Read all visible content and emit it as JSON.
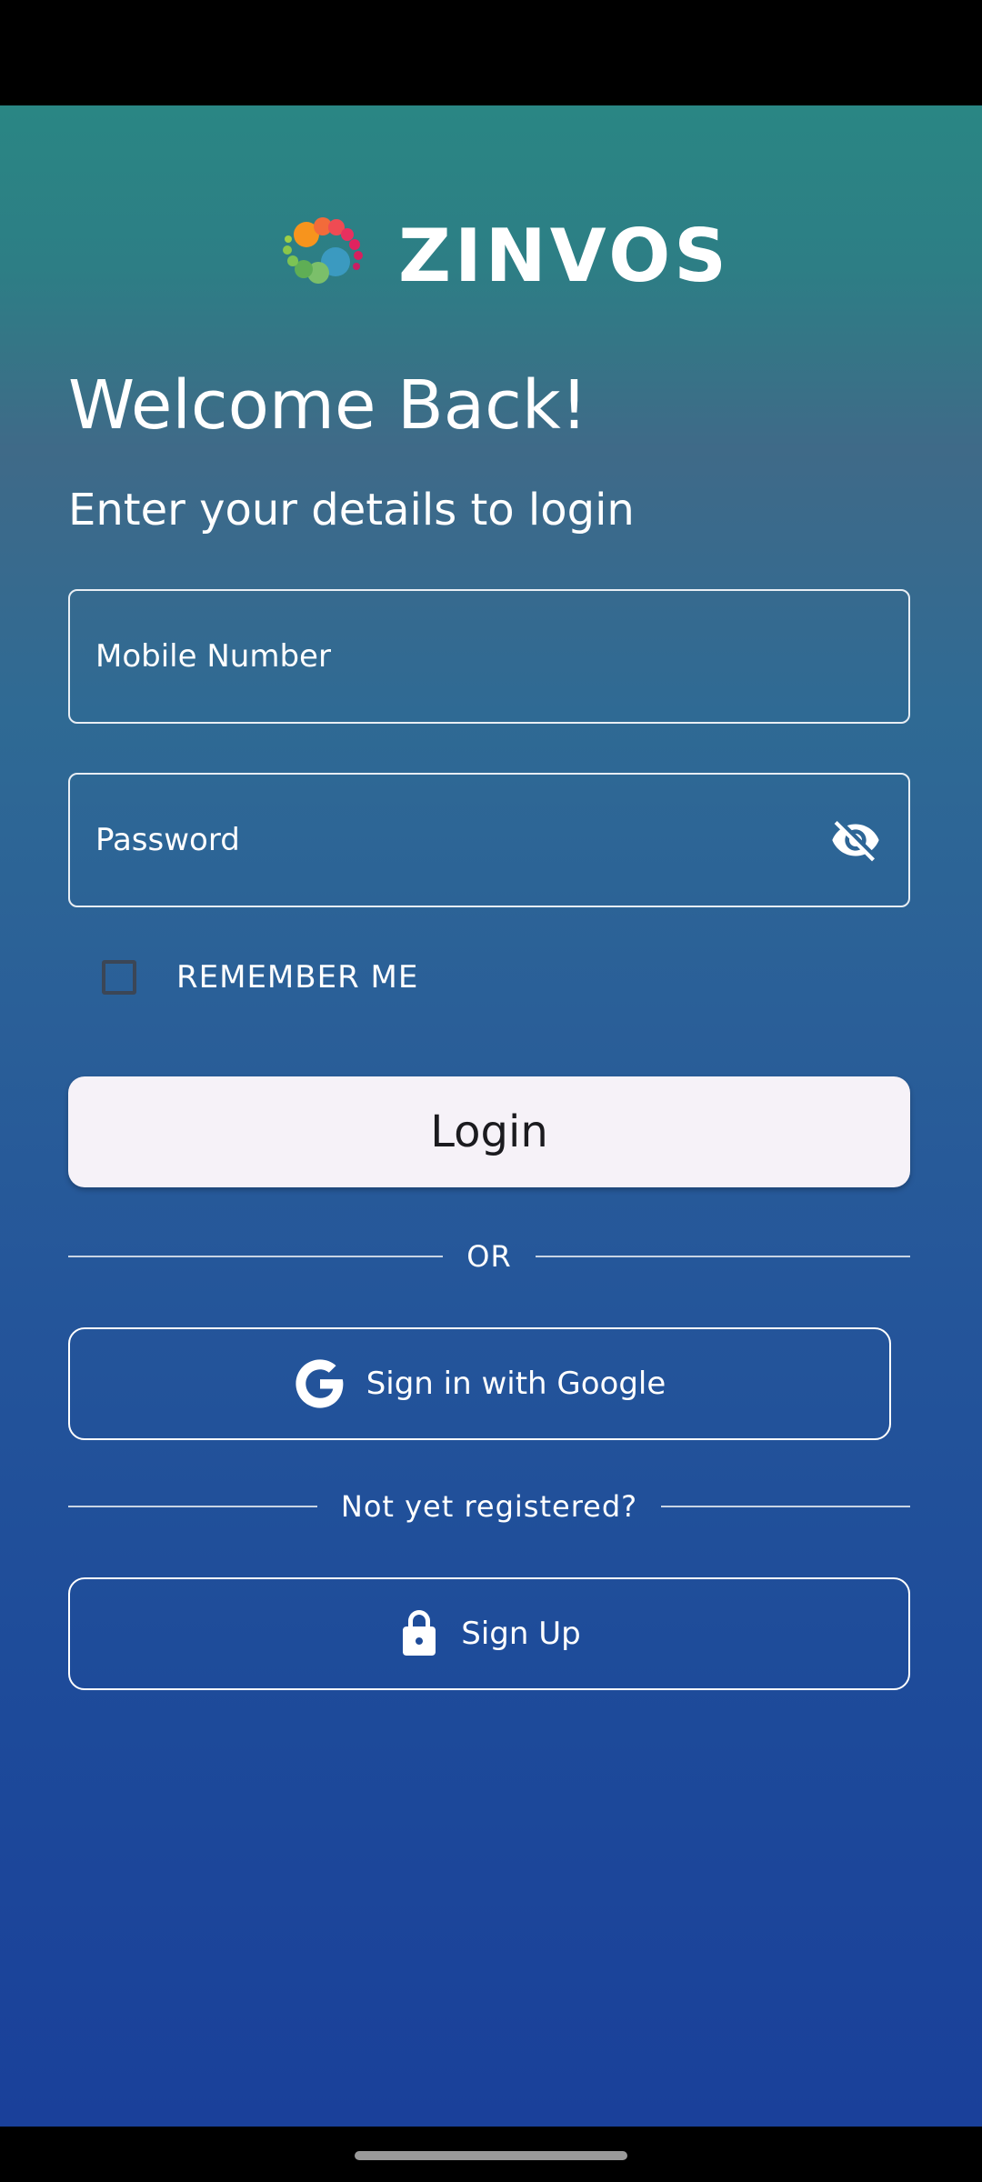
{
  "app": {
    "brand_name": "ZINVOS"
  },
  "header": {
    "welcome": "Welcome Back!",
    "subtitle": "Enter your details to login"
  },
  "form": {
    "mobile_placeholder": "Mobile Number",
    "mobile_value": "",
    "password_placeholder": "Password",
    "password_value": "",
    "remember_label": "REMEMBER ME",
    "remember_checked": false,
    "login_label": "Login"
  },
  "divider": {
    "or_label": "OR",
    "register_prompt": "Not yet registered?"
  },
  "social": {
    "google_label": "Sign in with Google"
  },
  "signup": {
    "label": "Sign Up"
  },
  "icons": {
    "password_toggle": "eye-off-icon",
    "google": "google-icon",
    "signup": "lock-icon"
  },
  "colors": {
    "gradient_top": "#2a8684",
    "gradient_bottom": "#1a409a",
    "login_button_bg": "#f6f2f8"
  }
}
